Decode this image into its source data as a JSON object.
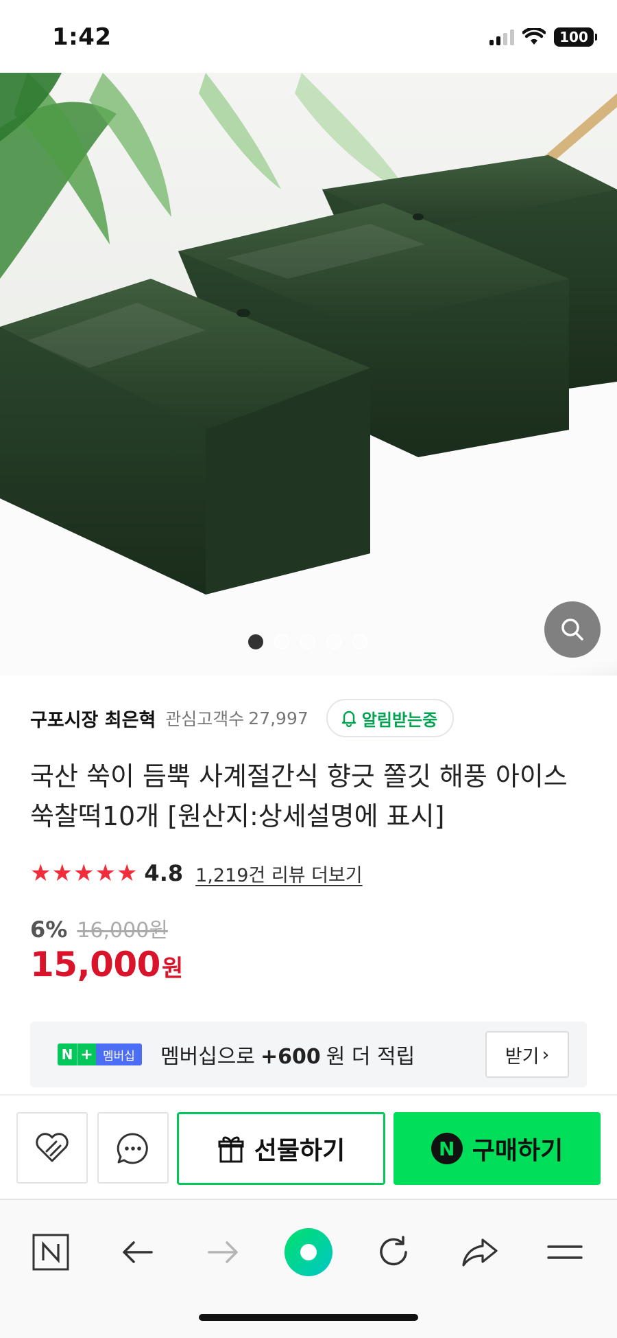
{
  "status_bar": {
    "time": "1:42",
    "battery": "100"
  },
  "gallery": {
    "image_count": 5,
    "active_index": 0
  },
  "seller": {
    "name": "구포시장 최은혁",
    "follower_label": "관심고객수",
    "follower_count": "27,997",
    "alarm_label": "알림받는중"
  },
  "product": {
    "title": "국산 쑥이 듬뿍 사계절간식 향긋 쫄깃 해풍 아이스 쑥찰떡10개 [원산지:상세설명에 표시]",
    "rating": "4.8",
    "rating_stars": 5,
    "review_link": "1,219건 리뷰 더보기",
    "discount_rate": "6%",
    "original_price": "16,000원",
    "sale_price": "15,000",
    "sale_unit": "원"
  },
  "membership": {
    "badge_n": "N",
    "badge_plus": "+",
    "badge_label": "멤버십",
    "text_prefix": "멤버십으로",
    "points": "+600",
    "text_suffix": "원 더 적립",
    "receive_label": "받기",
    "receive_chevron": "›"
  },
  "actions": {
    "gift_label": "선물하기",
    "buy_label": "구매하기",
    "npay_letter": "N"
  },
  "browser_nav": {
    "home_letter": "N"
  },
  "colors": {
    "naver_green": "#03c75a",
    "buy_green": "#00de5a",
    "price_red": "#d8132a",
    "star_red": "#f02d3a"
  }
}
